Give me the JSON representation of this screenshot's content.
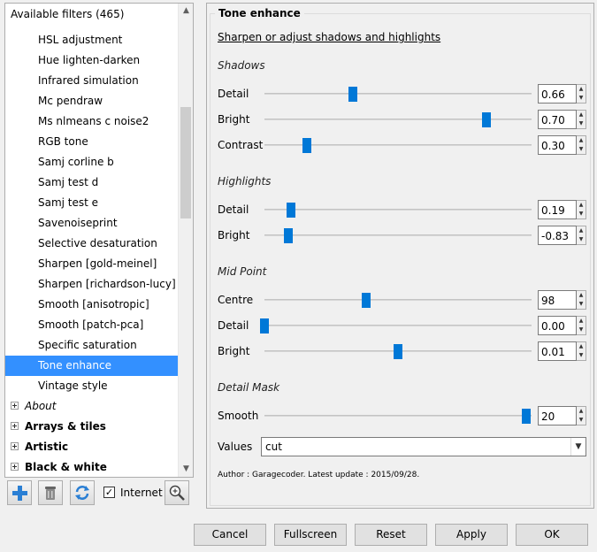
{
  "left": {
    "header": "Available filters (465)",
    "items": [
      {
        "label": "HSL adjustment",
        "type": "sub"
      },
      {
        "label": "Hue lighten-darken",
        "type": "sub"
      },
      {
        "label": "Infrared simulation",
        "type": "sub"
      },
      {
        "label": "Mc pendraw",
        "type": "sub"
      },
      {
        "label": "Ms nlmeans c noise2",
        "type": "sub"
      },
      {
        "label": "RGB tone",
        "type": "sub"
      },
      {
        "label": "Samj corline b",
        "type": "sub"
      },
      {
        "label": "Samj test d",
        "type": "sub"
      },
      {
        "label": "Samj test e",
        "type": "sub"
      },
      {
        "label": "Savenoiseprint",
        "type": "sub"
      },
      {
        "label": "Selective desaturation",
        "type": "sub"
      },
      {
        "label": "Sharpen [gold-meinel]",
        "type": "sub"
      },
      {
        "label": "Sharpen [richardson-lucy]",
        "type": "sub"
      },
      {
        "label": "Smooth [anisotropic]",
        "type": "sub"
      },
      {
        "label": "Smooth [patch-pca]",
        "type": "sub"
      },
      {
        "label": "Specific saturation",
        "type": "sub"
      },
      {
        "label": "Tone enhance",
        "type": "sub",
        "selected": true
      },
      {
        "label": "Vintage style",
        "type": "sub"
      },
      {
        "label": "About",
        "type": "group",
        "style": "italic"
      },
      {
        "label": "Arrays & tiles",
        "type": "group",
        "style": "bold"
      },
      {
        "label": "Artistic",
        "type": "group",
        "style": "bold"
      },
      {
        "label": "Black & white",
        "type": "group",
        "style": "bold"
      }
    ],
    "internet_label": "Internet",
    "internet_checked": true,
    "scroll_up_icon": "▲",
    "scroll_down_icon": "▼"
  },
  "filter": {
    "title": "Tone enhance",
    "subtitle": "Sharpen or adjust shadows and highlights",
    "sections": [
      {
        "title": "Shadows",
        "params": [
          {
            "label": "Detail",
            "value": "0.66",
            "level": 0.33
          },
          {
            "label": "Bright",
            "value": "0.70",
            "level": 0.83
          },
          {
            "label": "Contrast",
            "value": "0.30",
            "level": 0.16
          }
        ]
      },
      {
        "title": "Highlights",
        "params": [
          {
            "label": "Detail",
            "value": "0.19",
            "level": 0.1
          },
          {
            "label": "Bright",
            "value": "-0.83",
            "level": 0.09
          }
        ]
      },
      {
        "title": "Mid Point",
        "params": [
          {
            "label": "Centre",
            "value": "98",
            "level": 0.38
          },
          {
            "label": "Detail",
            "value": "0.00",
            "level": 0.0
          },
          {
            "label": "Bright",
            "value": "0.01",
            "level": 0.5
          }
        ]
      },
      {
        "title": "Detail Mask",
        "params": [
          {
            "label": "Smooth",
            "value": "20",
            "level": 0.98
          }
        ]
      }
    ],
    "values_label": "Values",
    "values_selected": "cut",
    "author_line": "Author : Garagecoder.     Latest update : 2015/09/28."
  },
  "buttons": {
    "cancel": "Cancel",
    "fullscreen": "Fullscreen",
    "reset": "Reset",
    "apply": "Apply",
    "ok": "OK"
  },
  "colors": {
    "accent": "#0078d7",
    "selection": "#3390ff"
  }
}
